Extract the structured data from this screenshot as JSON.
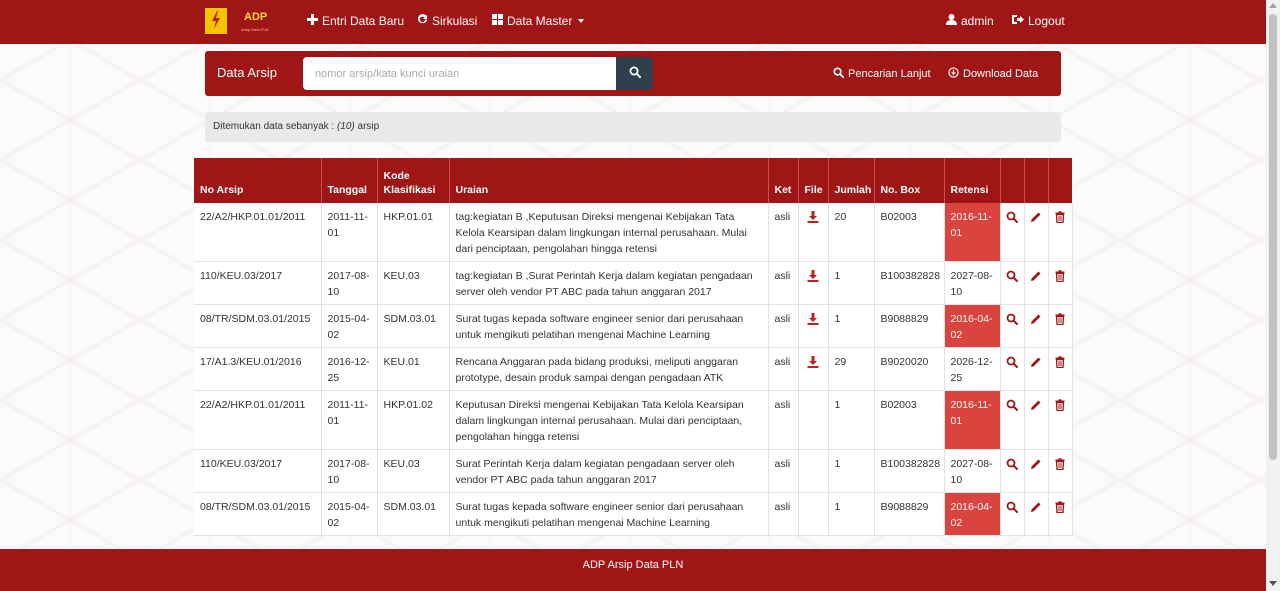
{
  "nav": {
    "brand": "ADP",
    "brand_sub": "Arsip Data PLN",
    "entri_label": "Entri Data Baru",
    "sirkulasi_label": "Sirkulasi",
    "data_master_label": "Data Master",
    "user_label": "admin",
    "logout_label": "Logout"
  },
  "panel": {
    "title": "Data Arsip",
    "search_placeholder": "nomor arsip/kata kunci uraian",
    "advanced_label": "Pencarian Lanjut",
    "download_label": "Download Data"
  },
  "info": {
    "prefix": "Ditemukan data sebanyak : ",
    "count": "(10)",
    "suffix": " arsip"
  },
  "table": {
    "headers": {
      "no_arsip": "No Arsip",
      "tanggal": "Tanggal",
      "kode": "Kode Klasifikasi",
      "uraian": "Uraian",
      "ket": "Ket",
      "file": "File",
      "jumlah": "Jumlah",
      "no_box": "No. Box",
      "retensi": "Retensi"
    },
    "rows": [
      {
        "no": "22/A2/HKP.01.01/2011",
        "tanggal": "2011-11-01",
        "kode": "HKP.01.01",
        "uraian": "tag:kegiatan B ,Keputusan Direksi mengenai Kebijakan Tata Kelola Kearsipan dalam lingkungan internal perusahaan. Mulai dari penciptaan, pengolahan hingga retensi",
        "ket": "asli",
        "file": true,
        "jumlah": "20",
        "box": "B02003",
        "retensi": "2016-11-01",
        "expired": true
      },
      {
        "no": "110/KEU.03/2017",
        "tanggal": "2017-08-10",
        "kode": "KEU.03",
        "uraian": "tag:kegiatan B ,Surat Perintah Kerja dalam kegiatan pengadaan server oleh vendor PT ABC pada tahun anggaran 2017",
        "ket": "asli",
        "file": true,
        "jumlah": "1",
        "box": "B100382828",
        "retensi": "2027-08-10",
        "expired": false
      },
      {
        "no": "08/TR/SDM.03.01/2015",
        "tanggal": "2015-04-02",
        "kode": "SDM.03.01",
        "uraian": "Surat tugas kepada software engineer senior dari perusahaan untuk mengikuti pelatihan mengenai Machine Learning",
        "ket": "asli",
        "file": true,
        "jumlah": "1",
        "box": "B9088829",
        "retensi": "2016-04-02",
        "expired": true
      },
      {
        "no": "17/A1.3/KEU.01/2016",
        "tanggal": "2016-12-25",
        "kode": "KEU.01",
        "uraian": "Rencana Anggaran pada bidang produksi, meliputi anggaran prototype, desain produk sampai dengan pengadaan ATK",
        "ket": "asli",
        "file": true,
        "jumlah": "29",
        "box": "B9020020",
        "retensi": "2026-12-25",
        "expired": false
      },
      {
        "no": "22/A2/HKP.01.01/2011",
        "tanggal": "2011-11-01",
        "kode": "HKP.01.02",
        "uraian": "Keputusan Direksi mengenai Kebijakan Tata Kelola Kearsipan dalam lingkungan internal perusahaan. Mulai dari penciptaan, pengolahan hingga retensi",
        "ket": "asli",
        "file": false,
        "jumlah": "1",
        "box": "B02003",
        "retensi": "2016-11-01",
        "expired": true
      },
      {
        "no": "110/KEU.03/2017",
        "tanggal": "2017-08-10",
        "kode": "KEU.03",
        "uraian": "Surat Perintah Kerja dalam kegiatan pengadaan server oleh vendor PT ABC pada tahun anggaran 2017",
        "ket": "asli",
        "file": false,
        "jumlah": "1",
        "box": "B100382828",
        "retensi": "2027-08-10",
        "expired": false
      },
      {
        "no": "08/TR/SDM.03.01/2015",
        "tanggal": "2015-04-02",
        "kode": "SDM.03.01",
        "uraian": "Surat tugas kepada software engineer senior dari perusahaan untuk mengikuti pelatihan mengenai Machine Learning",
        "ket": "asli",
        "file": false,
        "jumlah": "1",
        "box": "B9088829",
        "retensi": "2016-04-02",
        "expired": true
      }
    ]
  },
  "footer": {
    "text": "ADP Arsip Data PLN"
  },
  "colors": {
    "primary": "#a01515",
    "expired": "#d9453e",
    "search_btn": "#2f3f4d"
  },
  "icons": {
    "file": "download-icon",
    "view": "search-icon",
    "edit": "pencil-icon",
    "delete": "trash-icon"
  }
}
